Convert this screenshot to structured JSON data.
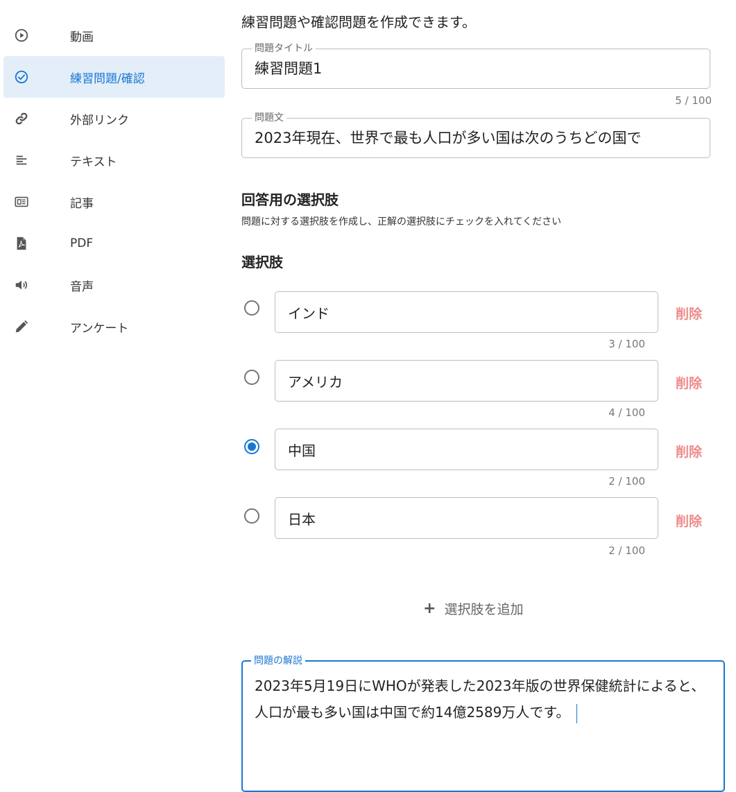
{
  "sidebar": {
    "items": [
      {
        "label": "動画",
        "icon": "play-circle-icon"
      },
      {
        "label": "練習問題/確認",
        "icon": "check-circle-icon",
        "active": true
      },
      {
        "label": "外部リンク",
        "icon": "link-icon"
      },
      {
        "label": "テキスト",
        "icon": "text-lines-icon"
      },
      {
        "label": "記事",
        "icon": "article-icon"
      },
      {
        "label": "PDF",
        "icon": "pdf-icon"
      },
      {
        "label": "音声",
        "icon": "speaker-icon"
      },
      {
        "label": "アンケート",
        "icon": "pencil-icon"
      }
    ]
  },
  "main": {
    "intro": "練習問題や確認問題を作成できます。",
    "title_field": {
      "label": "問題タイトル",
      "value": "練習問題1",
      "counter": "5 / 100"
    },
    "question_field": {
      "label": "問題文",
      "value": "2023年現在、世界で最も人口が多い国は次のうちどの国で"
    },
    "answers_section": {
      "title": "回答用の選択肢",
      "subtitle": "問題に対する選択肢を作成し、正解の選択肢にチェックを入れてください"
    },
    "options_title": "選択肢",
    "options": [
      {
        "value": "インド",
        "counter": "3 / 100",
        "checked": false,
        "delete_label": "削除"
      },
      {
        "value": "アメリカ",
        "counter": "4 / 100",
        "checked": false,
        "delete_label": "削除"
      },
      {
        "value": "中国",
        "counter": "2 / 100",
        "checked": true,
        "delete_label": "削除"
      },
      {
        "value": "日本",
        "counter": "2 / 100",
        "checked": false,
        "delete_label": "削除"
      }
    ],
    "add_option_label": "選択肢を追加",
    "explanation_field": {
      "label": "問題の解説",
      "value": "2023年5月19日にWHOが発表した2023年版の世界保健統計によると、人口が最も多い国は中国で約14億2589万人です。"
    }
  },
  "colors": {
    "accent": "#1976d2",
    "active_bg": "#e3eef9",
    "delete": "#ef8a8a",
    "border": "#bdbdbd"
  }
}
